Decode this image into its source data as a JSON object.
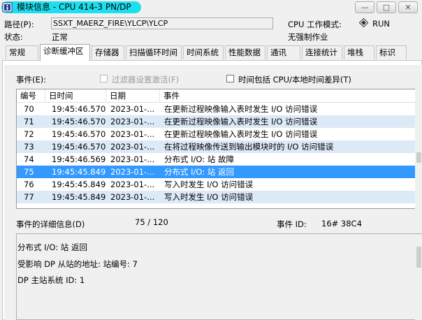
{
  "window": {
    "title": "模块信息 - CPU 414-3 PN/DP",
    "minimize_label": "—",
    "maximize_label": "□",
    "close_label": "✕"
  },
  "header": {
    "path_label": "路径(P):",
    "path_value": "SSXT_MAERZ_FIRE\\YLCP\\YLCP",
    "status_label": "状态:",
    "status_value": "正常",
    "cpu_mode_label": "CPU 工作模式:",
    "cpu_mode_value": "RUN",
    "force_value": "无强制作业"
  },
  "tabs": [
    {
      "label": "常规"
    },
    {
      "label": "诊断缓冲区"
    },
    {
      "label": "存储器"
    },
    {
      "label": "扫描循环时间"
    },
    {
      "label": "时间系统"
    },
    {
      "label": "性能数据"
    },
    {
      "label": "通讯"
    },
    {
      "label": "连接统计"
    },
    {
      "label": "堆栈"
    },
    {
      "label": "标识"
    }
  ],
  "events_section": {
    "label": "事件(E):",
    "filter_checkbox_label": "过滤器设置激活(F)",
    "filter_checked": false,
    "time_checkbox_label": "时间包括 CPU/本地时间差异(T)",
    "time_checked": false
  },
  "table": {
    "columns": [
      "编号",
      "日时间",
      "日期",
      "事件"
    ],
    "rows": [
      {
        "no": "70",
        "time": "19:45:46.570",
        "date": "2023-01-...",
        "event": "在更新过程映像输入表时发生 I/O 访问错误"
      },
      {
        "no": "71",
        "time": "19:45:46.570",
        "date": "2023-01-...",
        "event": "在更新过程映像输入表时发生 I/O 访问错误"
      },
      {
        "no": "72",
        "time": "19:45:46.570",
        "date": "2023-01-...",
        "event": "在更新过程映像输入表时发生 I/O 访问错误"
      },
      {
        "no": "73",
        "time": "19:45:46.570",
        "date": "2023-01-...",
        "event": "在将过程映像传送到输出模块时的 I/O 访问错误"
      },
      {
        "no": "74",
        "time": "19:45:46.569",
        "date": "2023-01-...",
        "event": "分布式 I/O: 站 故障"
      },
      {
        "no": "75",
        "time": "19:45:45.849",
        "date": "2023-01-...",
        "event": "分布式 I/O: 站 返回"
      },
      {
        "no": "76",
        "time": "19:45:45.849",
        "date": "2023-01-...",
        "event": "写入时发生 I/O 访问错误"
      },
      {
        "no": "77",
        "time": "19:45:45.849",
        "date": "2023-01-...",
        "event": "写入时发生 I/O 访问错误"
      }
    ],
    "selected_row": "75"
  },
  "details": {
    "label": "事件的详细信息(D)",
    "position": "75 / 120",
    "event_id_label": "事件 ID:",
    "event_id_value": "16# 38C4",
    "lines": [
      "分布式 I/O: 站 返回",
      "受影响 DP 从站的地址: 站编号:    7",
      "DP 主站系统 ID:     1"
    ]
  }
}
